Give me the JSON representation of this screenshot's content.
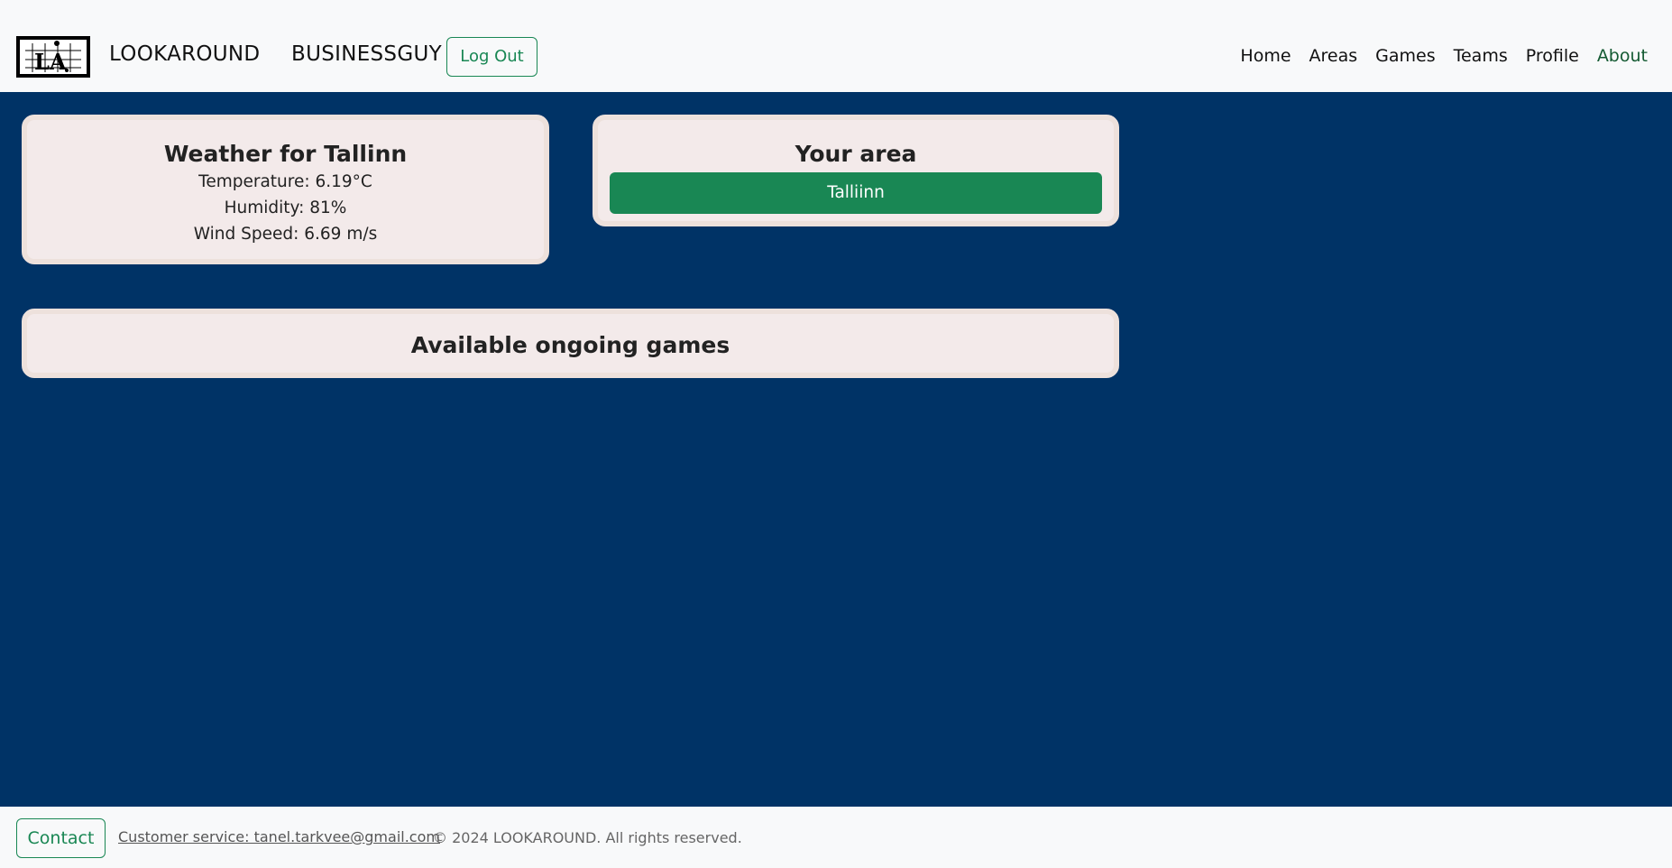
{
  "header": {
    "brand": "LOOKAROUND",
    "username": "BUSINESSGUY",
    "logout_label": "Log Out",
    "logo_text": "LA",
    "nav": [
      "Home",
      "Areas",
      "Games",
      "Teams",
      "Profile",
      "About"
    ]
  },
  "weather": {
    "title": "Weather for Tallinn",
    "temperature": "Temperature: 6.19°C",
    "humidity": "Humidity: 81%",
    "wind": "Wind Speed: 6.69 m/s"
  },
  "area": {
    "title": "Your area",
    "selected_area": "Talliinn"
  },
  "games": {
    "title": "Available ongoing games"
  },
  "footer": {
    "contact_label": "Contact",
    "customer_service": "Customer service: tanel.tarkvee@gmail.com",
    "copyright": "© 2024 LOOKAROUND. All rights reserved."
  },
  "colors": {
    "page_background": "#003366",
    "header_background": "#f8f9fa",
    "accent_green": "#198754",
    "card_background": "#f3eaea"
  }
}
